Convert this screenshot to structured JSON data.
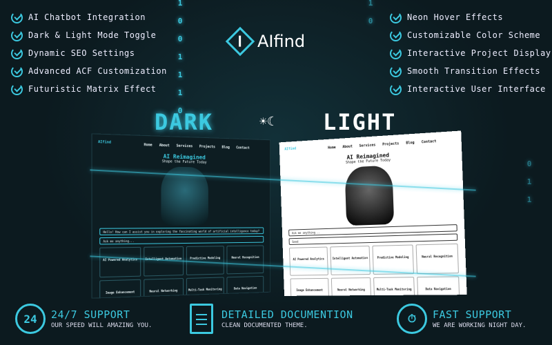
{
  "features_left": [
    "AI Chatbot Integration",
    "Dark & Light Mode Toggle",
    "Dynamic SEO Settings",
    "Advanced ACF Customization",
    "Futuristic Matrix Effect"
  ],
  "features_right": [
    "Neon Hover Effects",
    "Customizable Color Scheme",
    "Interactive Project Display",
    "Smooth Transition Effects",
    "Interactive User Interface"
  ],
  "logo": "AIfind",
  "modes": {
    "dark": "DARK",
    "light": "LIGHT",
    "toggle_icons": "☀☾"
  },
  "matrix_col": [
    "1",
    "0",
    "0",
    "1",
    "1",
    "1",
    "0"
  ],
  "mockup": {
    "logo": "AIfind",
    "nav": [
      "Home",
      "About",
      "Services",
      "Projects",
      "Blog",
      "Contact"
    ],
    "hero_title": "AI Reimagined",
    "hero_subtitle": "Shape the Future Today",
    "chat_prompt": "Hello! How can I assist you in exploring the fascinating world of artificial intelligence today?",
    "input_placeholder": "Ask me anything...",
    "send": "Send",
    "cards": [
      "AI Powered Analytics",
      "Intelligent Automation",
      "Predictive Modeling",
      "Neural Recognition",
      "Image Enhancement",
      "Neural Networking",
      "Multi-Task Monitoring",
      "Data Navigation"
    ]
  },
  "footer": [
    {
      "icon": "24",
      "title": "24/7 SUPPORT",
      "subtitle": "OUR SPEED WILL AMAZING YOU."
    },
    {
      "title": "DETAILED DOCUMENTION",
      "subtitle": "CLEAN DOCUMENTED THEME."
    },
    {
      "title": "FAST SUPPORT",
      "subtitle": "WE ARE WORKING NIGHT DAY."
    }
  ],
  "colors": {
    "accent": "#3cc9e0",
    "background": "#0c1a1f"
  }
}
